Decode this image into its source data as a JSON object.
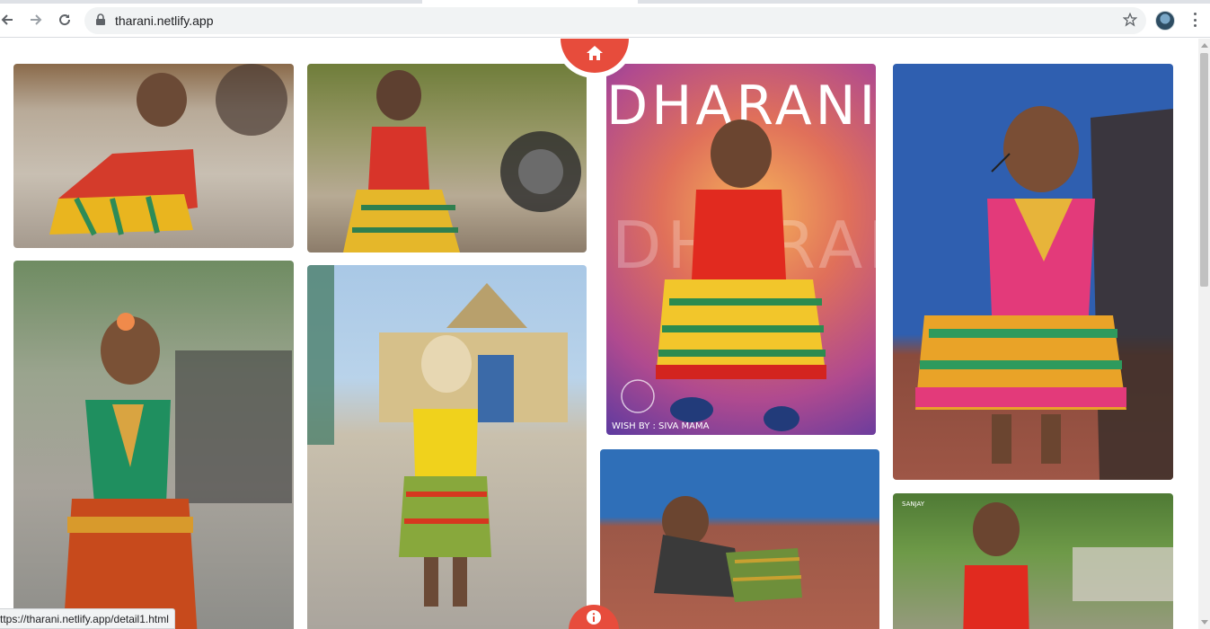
{
  "browser": {
    "url": "tharani.netlify.app",
    "status_link": "ttps://tharani.netlify.app/detail1.html"
  },
  "icons": {
    "back": "arrow-left-icon",
    "forward": "arrow-right-icon",
    "reload": "reload-icon",
    "secure": "lock-icon",
    "bookmark": "star-icon",
    "menu": "more-vert-icon",
    "home": "home-icon",
    "info": "info-icon"
  },
  "gallery": {
    "poster_title": "DHARANI",
    "poster_ghost": "DHARANI",
    "poster_credit": "WISH BY : SIVA MAMA",
    "photo_tag": "SANJAY"
  },
  "colors": {
    "accent": "#e74c3c"
  }
}
